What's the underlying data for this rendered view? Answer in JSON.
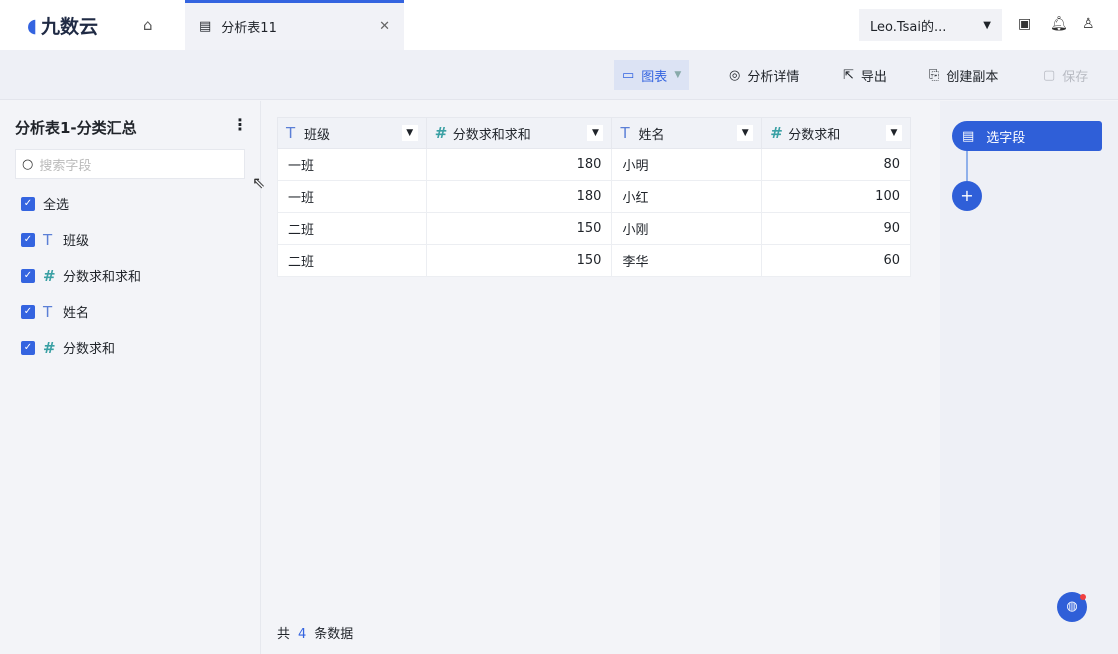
{
  "app": {
    "logo": "九数云"
  },
  "tab": {
    "label": "分析表11"
  },
  "user": {
    "name": "Leo.Tsai的..."
  },
  "toolbar": {
    "chart": "图表",
    "details": "分析详情",
    "export": "导出",
    "copy": "创建副本",
    "save": "保存"
  },
  "left": {
    "title": "分析表1-分类汇总",
    "search_placeholder": "搜索字段",
    "select_all": "全选",
    "fields": [
      {
        "type": "T",
        "name": "班级"
      },
      {
        "type": "#",
        "name": "分数求和求和"
      },
      {
        "type": "T",
        "name": "姓名"
      },
      {
        "type": "#",
        "name": "分数求和"
      }
    ]
  },
  "table": {
    "columns": [
      {
        "type": "T",
        "name": "班级"
      },
      {
        "type": "#",
        "name": "分数求和求和"
      },
      {
        "type": "T",
        "name": "姓名"
      },
      {
        "type": "#",
        "name": "分数求和"
      }
    ],
    "rows": [
      [
        "一班",
        "180",
        "小明",
        "80"
      ],
      [
        "一班",
        "180",
        "小红",
        "100"
      ],
      [
        "二班",
        "150",
        "小刚",
        "90"
      ],
      [
        "二班",
        "150",
        "李华",
        "60"
      ]
    ]
  },
  "footer": {
    "prefix": "共",
    "count": "4",
    "suffix": "条数据"
  },
  "right": {
    "step": "选字段",
    "add": "+"
  },
  "colors": {
    "accent": "#3464e0"
  }
}
